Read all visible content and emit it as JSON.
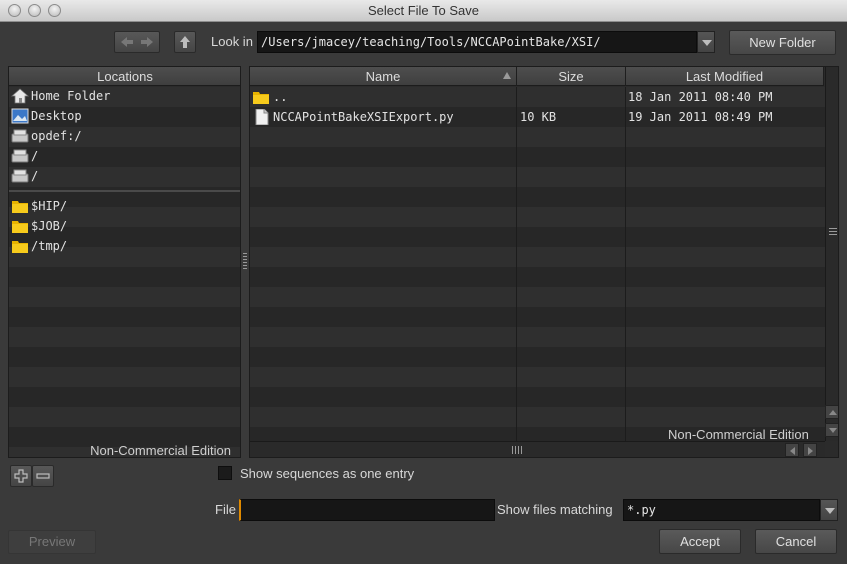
{
  "window": {
    "title": "Select File To Save"
  },
  "toolbar": {
    "look_in_label": "Look in",
    "path_value": "/Users/jmacey/teaching/Tools/NCCAPointBake/XSI/",
    "new_folder_label": "New Folder"
  },
  "locations": {
    "header": "Locations",
    "items": [
      {
        "label": "Home Folder",
        "icon": "home-icon"
      },
      {
        "label": "Desktop",
        "icon": "desktop-icon"
      },
      {
        "label": "opdef:/",
        "icon": "drive-icon"
      },
      {
        "label": "/",
        "icon": "drive-icon"
      },
      {
        "label": "/",
        "icon": "drive-icon"
      }
    ],
    "vars": [
      {
        "label": "$HIP/",
        "icon": "folder-icon"
      },
      {
        "label": "$JOB/",
        "icon": "folder-icon"
      },
      {
        "label": "/tmp/",
        "icon": "folder-icon"
      }
    ],
    "watermark": "Non-Commercial Edition"
  },
  "files": {
    "columns": {
      "name": "Name",
      "size": "Size",
      "modified": "Last Modified"
    },
    "rows": [
      {
        "name": "..",
        "size": "",
        "modified": "18 Jan 2011 08:40 PM",
        "icon": "folder-icon"
      },
      {
        "name": "NCCAPointBakeXSIExport.py",
        "size": "10 KB",
        "modified": "19 Jan 2011 08:49 PM",
        "icon": "file-icon"
      }
    ],
    "watermark": "Non-Commercial Edition"
  },
  "options": {
    "sequences_label": "Show sequences as one entry"
  },
  "file_row": {
    "file_label": "File",
    "file_value": "",
    "filter_label": "Show files matching",
    "filter_value": "*.py"
  },
  "buttons": {
    "preview": "Preview",
    "accept": "Accept",
    "cancel": "Cancel"
  }
}
